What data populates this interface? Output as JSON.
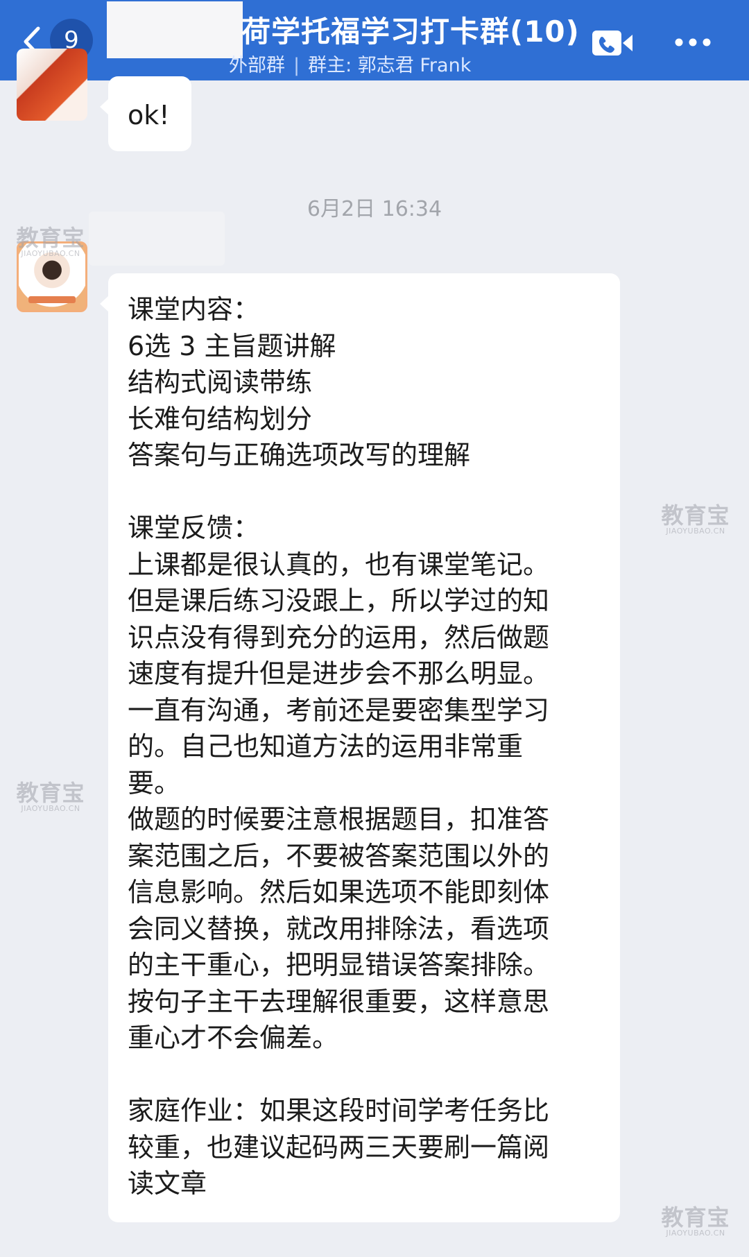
{
  "header": {
    "back_label": "9",
    "title": "荷学托福学习打卡群(10)",
    "subtitle_tag": "外部群",
    "subtitle_separator": "|",
    "subtitle_owner": "群主: 郭志君 Frank",
    "icons": {
      "back": "chevron-left-icon",
      "call": "video-call-icon",
      "more": "more-dots-icon"
    },
    "colors": {
      "bar": "#2f6fd4",
      "badge": "#1f52ab"
    }
  },
  "messages": [
    {
      "type": "text",
      "text": "ok!"
    },
    {
      "type": "timestamp",
      "text": "6月2日 16:34"
    },
    {
      "type": "text",
      "text": "课堂内容：\n6选 3 主旨题讲解\n结构式阅读带练\n长难句结构划分\n答案句与正确选项改写的理解\n\n课堂反馈：\n上课都是很认真的，也有课堂笔记。\n但是课后练习没跟上，所以学过的知\n识点没有得到充分的运用，然后做题\n速度有提升但是进步会不那么明显。\n一直有沟通，考前还是要密集型学习\n的。自己也知道方法的运用非常重\n要。\n做题的时候要注意根据题目，扣准答\n案范围之后，不要被答案范围以外的\n信息影响。然后如果选项不能即刻体\n会同义替换，就改用排除法，看选项\n的主干重心，把明显错误答案排除。\n按句子主干去理解很重要，这样意思\n重心才不会偏差。\n\n家庭作业：如果这段时间学考任务比\n较重，也建议起码两三天要刷一篇阅\n读文章"
    }
  ],
  "watermark": {
    "brand": "教育宝",
    "domain": "JIAOYUBAO.CN"
  },
  "colors": {
    "chat_background": "#eceef3",
    "bubble": "#ffffff",
    "timestamp_text": "#a2a5ab"
  }
}
